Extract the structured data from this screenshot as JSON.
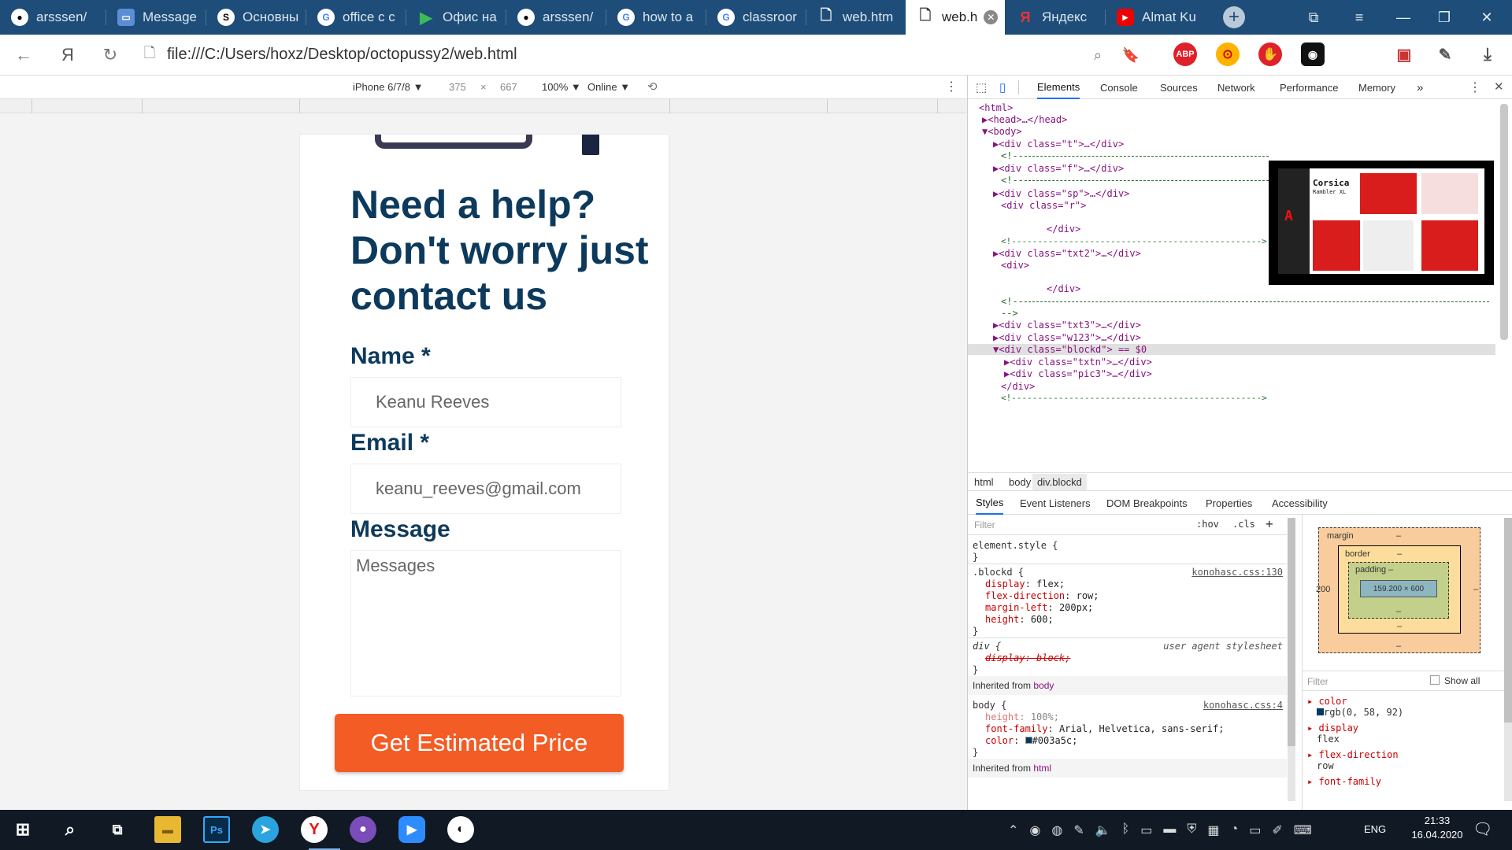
{
  "tabs": [
    {
      "label": "arsssen/",
      "icon": "github-icon"
    },
    {
      "label": "Message",
      "icon": "messenger-icon"
    },
    {
      "label": "Основны",
      "icon": "app-icon"
    },
    {
      "label": "office c с",
      "icon": "google-icon"
    },
    {
      "label": "Офис на",
      "icon": "play-icon"
    },
    {
      "label": "arsssen/",
      "icon": "github-icon"
    },
    {
      "label": "how to a",
      "icon": "google-icon"
    },
    {
      "label": "classroor",
      "icon": "google-icon"
    },
    {
      "label": "web.htm",
      "icon": "file-icon"
    },
    {
      "label": "web.h",
      "icon": "file-icon",
      "active": true
    },
    {
      "label": "Яндекс",
      "icon": "yandex-icon"
    },
    {
      "label": "Almat Ku",
      "icon": "youtube-icon"
    }
  ],
  "address": {
    "url": "file:///C:/Users/hoxz/Desktop/octopussy2/web.html"
  },
  "extensions": {
    "abp": "ABP"
  },
  "device_toolbar": {
    "device": "iPhone 6/7/8 ▼",
    "width": "375",
    "x": "×",
    "height": "667",
    "zoom": "100% ▼",
    "network": "Online ▼"
  },
  "page": {
    "heading": "Need a help? Don't worry just contact us",
    "name_label": "Name *",
    "name_value": "Keanu Reeves",
    "email_label": "Email *",
    "email_value": "keanu_reeves@gmail.com",
    "message_label": "Message",
    "message_placeholder": "Messages",
    "cta": "Get Estimated Price"
  },
  "devtools": {
    "tabs": [
      "Elements",
      "Console",
      "Sources",
      "Network",
      "Performance",
      "Memory"
    ],
    "more": "»",
    "elements": [
      "<html>",
      "▶<head>…</head>",
      "▼<body>",
      "▶<div class=\"t\">…</div>",
      "<!--",
      "▶<div class=\"f\">…</div>",
      "<!--",
      "▶<div class=\"sp\">…</div>",
      "<div class=\"r\">",
      "</div>",
      "<!------------------------------------------------>",
      "▶<div class=\"txt2\">…</div>",
      "<div>",
      "</div>",
      "<!--",
      "-->",
      "▶<div class=\"txt3\">…</div>",
      "▶<div class=\"w123\">…</div>",
      "▼<div class=\"blockd\"> == $0",
      "▶<div class=\"txtn\">…</div>",
      "▶<div class=\"pic3\">…</div>",
      "</div>",
      "<!------------------------------------------------>"
    ],
    "thumb_title": "Corsica",
    "thumb_sub": "Rambler XL",
    "breadcrumbs": [
      "html",
      "body",
      "div.blockd"
    ],
    "styles_tabs": [
      "Styles",
      "Event Listeners",
      "DOM Breakpoints",
      "Properties",
      "Accessibility"
    ],
    "filter_placeholder": "Filter",
    "hov": ":hov",
    "cls": ".cls",
    "styles": {
      "element_style": "element.style {",
      "close": "}",
      "blockd_sel": ".blockd {",
      "blockd_src": "konohasc.css:130",
      "blockd_props": [
        {
          "p": "display",
          "v": "flex;"
        },
        {
          "p": "flex-direction",
          "v": "row;"
        },
        {
          "p": "margin-left",
          "v": "200px;"
        },
        {
          "p": "height",
          "v": "600;"
        }
      ],
      "div_sel": "div {",
      "div_src": "user agent stylesheet",
      "div_prop": "display: block;",
      "inherited_body": "Inherited from",
      "inherited_body_link": "body",
      "body_sel": "body {",
      "body_src": "konohasc.css:4",
      "body_props": [
        {
          "p": "height",
          "v": "100%;"
        },
        {
          "p": "font-family",
          "v": "Arial, Helvetica, sans-serif;"
        },
        {
          "p": "color",
          "v": "#003a5c;"
        }
      ],
      "inherited_html": "Inherited from",
      "inherited_html_link": "html"
    },
    "box": {
      "margin": "margin",
      "border": "border",
      "padding": "padding",
      "content": "159.200 × 600",
      "dash": "–",
      "left_margin": "200"
    },
    "computed": {
      "filter": "Filter",
      "show_all": "Show all",
      "items": [
        {
          "p": "color",
          "v": "rgb(0, 58, 92)"
        },
        {
          "p": "display",
          "v": "flex"
        },
        {
          "p": "flex-direction",
          "v": "row"
        },
        {
          "p": "font-family",
          "v": ""
        }
      ]
    }
  },
  "taskbar": {
    "lang": "ENG",
    "time": "21:33",
    "date": "16.04.2020",
    "icons": [
      "windows-start-icon",
      "search-icon",
      "task-view-icon",
      "file-explorer-icon",
      "photoshop-icon",
      "telegram-icon",
      "yandex-browser-icon",
      "github-desktop-icon",
      "zoom-icon",
      "steam-icon"
    ]
  },
  "colors": {
    "tabbar": "#1d4d78",
    "accent": "#f35c24",
    "heading": "#0d3a5c",
    "taskbar": "#101924"
  }
}
